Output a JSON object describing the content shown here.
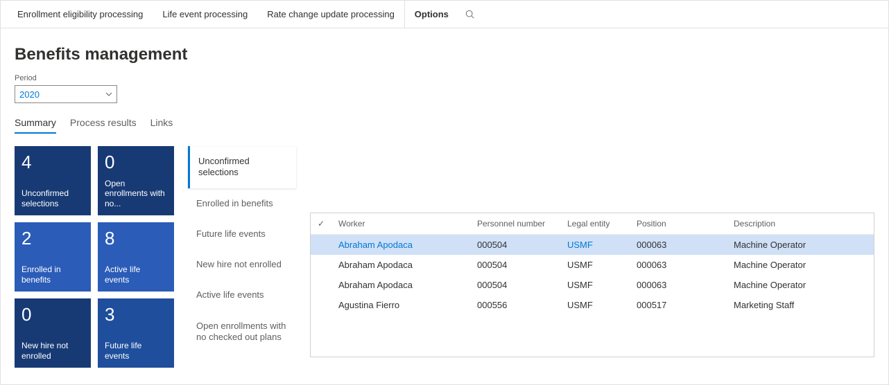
{
  "toolbar": {
    "items": [
      "Enrollment eligibility processing",
      "Life event processing",
      "Rate change update processing"
    ],
    "options": "Options"
  },
  "page": {
    "title": "Benefits management",
    "period_label": "Period",
    "period_value": "2020"
  },
  "tabs": [
    "Summary",
    "Process results",
    "Links"
  ],
  "tiles": [
    {
      "count": "4",
      "label": "Unconfirmed selections"
    },
    {
      "count": "0",
      "label": "Open enrollments with no..."
    },
    {
      "count": "2",
      "label": "Enrolled in benefits"
    },
    {
      "count": "8",
      "label": "Active life events"
    },
    {
      "count": "0",
      "label": "New hire not enrolled"
    },
    {
      "count": "3",
      "label": "Future life events"
    }
  ],
  "listnav": [
    "Unconfirmed selections",
    "Enrolled in benefits",
    "Future life events",
    "New hire not enrolled",
    "Active life events",
    "Open enrollments with no checked out plans"
  ],
  "grid": {
    "columns": [
      "Worker",
      "Personnel number",
      "Legal entity",
      "Position",
      "Description"
    ],
    "rows": [
      {
        "worker": "Abraham Apodaca",
        "pn": "000504",
        "le": "USMF",
        "pos": "000063",
        "desc": "Machine Operator",
        "selected": true
      },
      {
        "worker": "Abraham Apodaca",
        "pn": "000504",
        "le": "USMF",
        "pos": "000063",
        "desc": "Machine Operator",
        "selected": false
      },
      {
        "worker": "Abraham Apodaca",
        "pn": "000504",
        "le": "USMF",
        "pos": "000063",
        "desc": "Machine Operator",
        "selected": false
      },
      {
        "worker": "Agustina Fierro",
        "pn": "000556",
        "le": "USMF",
        "pos": "000517",
        "desc": "Marketing Staff",
        "selected": false
      }
    ]
  }
}
